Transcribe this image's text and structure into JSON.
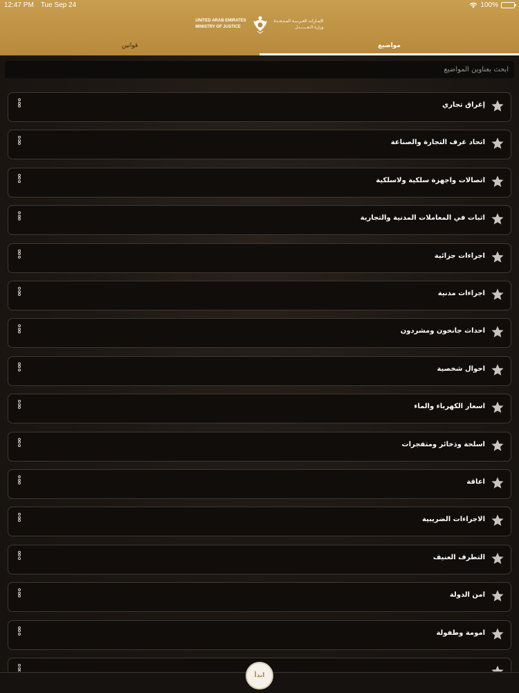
{
  "status": {
    "time": "12:47 PM",
    "date": "Tue Sep 24",
    "battery": "100%",
    "battery_level": 1.0
  },
  "header": {
    "logo_en_line1": "UNITED ARAB EMIRATES",
    "logo_en_line2": "MINISTRY OF JUSTICE",
    "logo_ar_line1": "الإمـارات العـربـيـة المـتـحـدة",
    "logo_ar_line2": "وزارة الـعــــــدل",
    "accent_color": "#c89e4f"
  },
  "tabs": [
    {
      "label": "قوانين",
      "active": false
    },
    {
      "label": "مواضيع",
      "active": true
    }
  ],
  "search": {
    "placeholder": "ابحث بعناوين المواضيع"
  },
  "items": [
    {
      "title": "إغراق تجاري"
    },
    {
      "title": "اتحاد غرف التجارة والصناعة"
    },
    {
      "title": "اتصالات واجهزة سلكية ولاسلكية"
    },
    {
      "title": "اثبات في المعاملات المدنية والتجارية"
    },
    {
      "title": "اجراءات جزائية"
    },
    {
      "title": "اجراءات مدنية"
    },
    {
      "title": "احداث جانحون ومشردون"
    },
    {
      "title": "احوال شخصية"
    },
    {
      "title": "اسعار الكهرباء والماء"
    },
    {
      "title": "اسلحة وذخائر ومتفجرات"
    },
    {
      "title": "اعاقة"
    },
    {
      "title": "الاجراءات الضريبية"
    },
    {
      "title": "التطرف العنيف"
    },
    {
      "title": "امن الدولة"
    },
    {
      "title": "امومة وطفولة"
    },
    {
      "title": ""
    }
  ],
  "start_button": {
    "label": "ابدأ"
  }
}
